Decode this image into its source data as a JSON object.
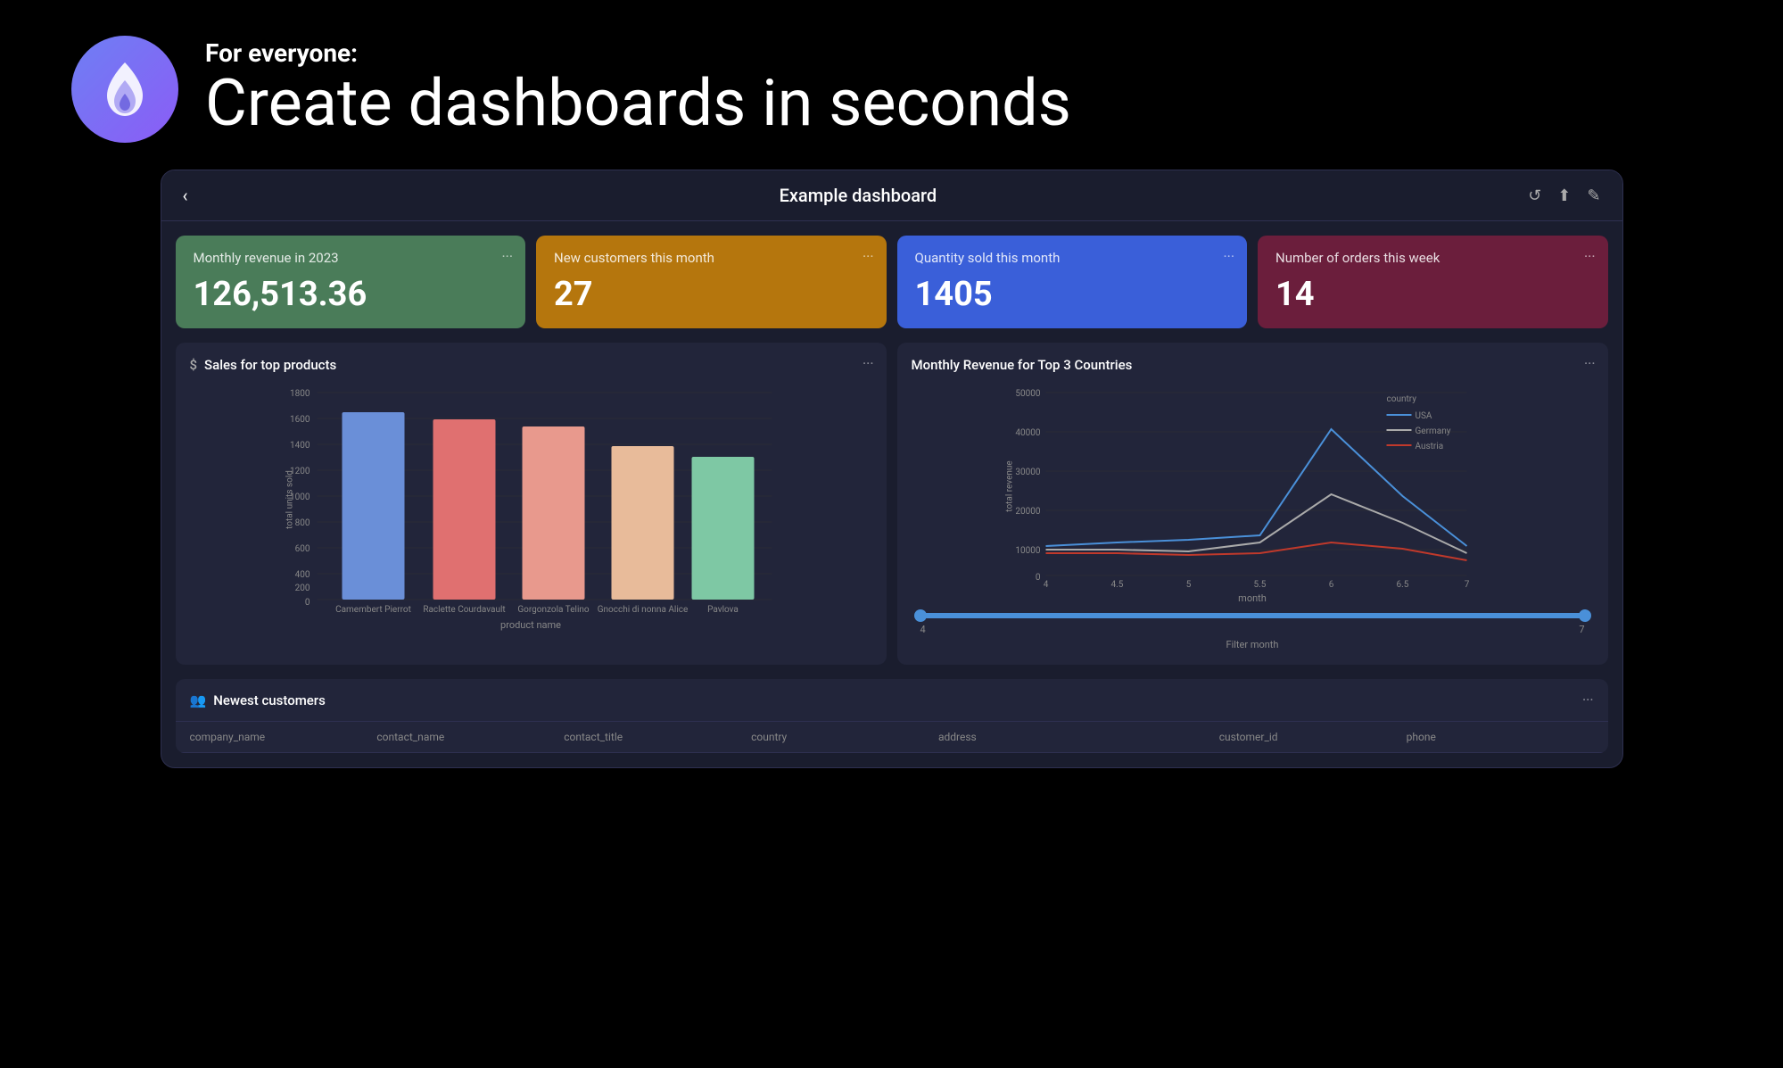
{
  "hero": {
    "subtitle": "For everyone:",
    "title": "Create dashboards in seconds",
    "logo_alt": "flame logo"
  },
  "dashboard": {
    "header": {
      "back_label": "‹",
      "title": "Example dashboard",
      "refresh_icon": "↺",
      "share_icon": "⬆",
      "edit_icon": "✎"
    },
    "kpi_cards": [
      {
        "label": "Monthly revenue in 2023",
        "value": "126,513.36",
        "color": "green",
        "dots": "···"
      },
      {
        "label": "New customers this month",
        "value": "27",
        "color": "amber",
        "dots": "···"
      },
      {
        "label": "Quantity sold this month",
        "value": "1405",
        "color": "blue",
        "dots": "···"
      },
      {
        "label": "Number of orders this week",
        "value": "14",
        "color": "maroon",
        "dots": "···"
      }
    ],
    "bar_chart": {
      "title": "Sales for top products",
      "icon": "$",
      "dots": "···",
      "y_axis_label": "total units sold",
      "x_axis_label": "product name",
      "y_max": 1800,
      "bars": [
        {
          "label": "Camembert Pierrot",
          "value": 1540,
          "color": "#6a8fd8"
        },
        {
          "label": "Raclette Courdavault",
          "value": 1480,
          "color": "#e07070"
        },
        {
          "label": "Gorgonzola Telino",
          "value": 1420,
          "color": "#e8998d"
        },
        {
          "label": "Gnocchi di nonna Alice",
          "value": 1260,
          "color": "#e8bb9a"
        },
        {
          "label": "Pavlova",
          "value": 1170,
          "color": "#7ec8a4"
        }
      ],
      "y_ticks": [
        0,
        200,
        400,
        600,
        800,
        1000,
        1200,
        1400,
        1600,
        1800
      ]
    },
    "line_chart": {
      "title": "Monthly Revenue for Top 3 Countries",
      "dots": "···",
      "x_label": "month",
      "y_label": "total revenue",
      "legend": {
        "title": "country",
        "items": [
          {
            "name": "USA",
            "color": "#4a90d9"
          },
          {
            "name": "Germany",
            "color": "#e07070"
          },
          {
            "name": "Austria",
            "color": "#c0392b"
          }
        ]
      },
      "x_ticks": [
        4,
        4.5,
        5,
        5.5,
        6,
        6.5,
        7
      ],
      "y_ticks": [
        0,
        10000,
        20000,
        30000,
        40000,
        50000
      ],
      "filter_label": "Filter month",
      "filter_min": 4,
      "filter_max": 7
    },
    "table": {
      "title": "Newest customers",
      "title_icon": "👥",
      "dots": "···",
      "columns": [
        "company_name",
        "contact_name",
        "contact_title",
        "country",
        "address",
        "customer_id",
        "phone"
      ]
    }
  }
}
